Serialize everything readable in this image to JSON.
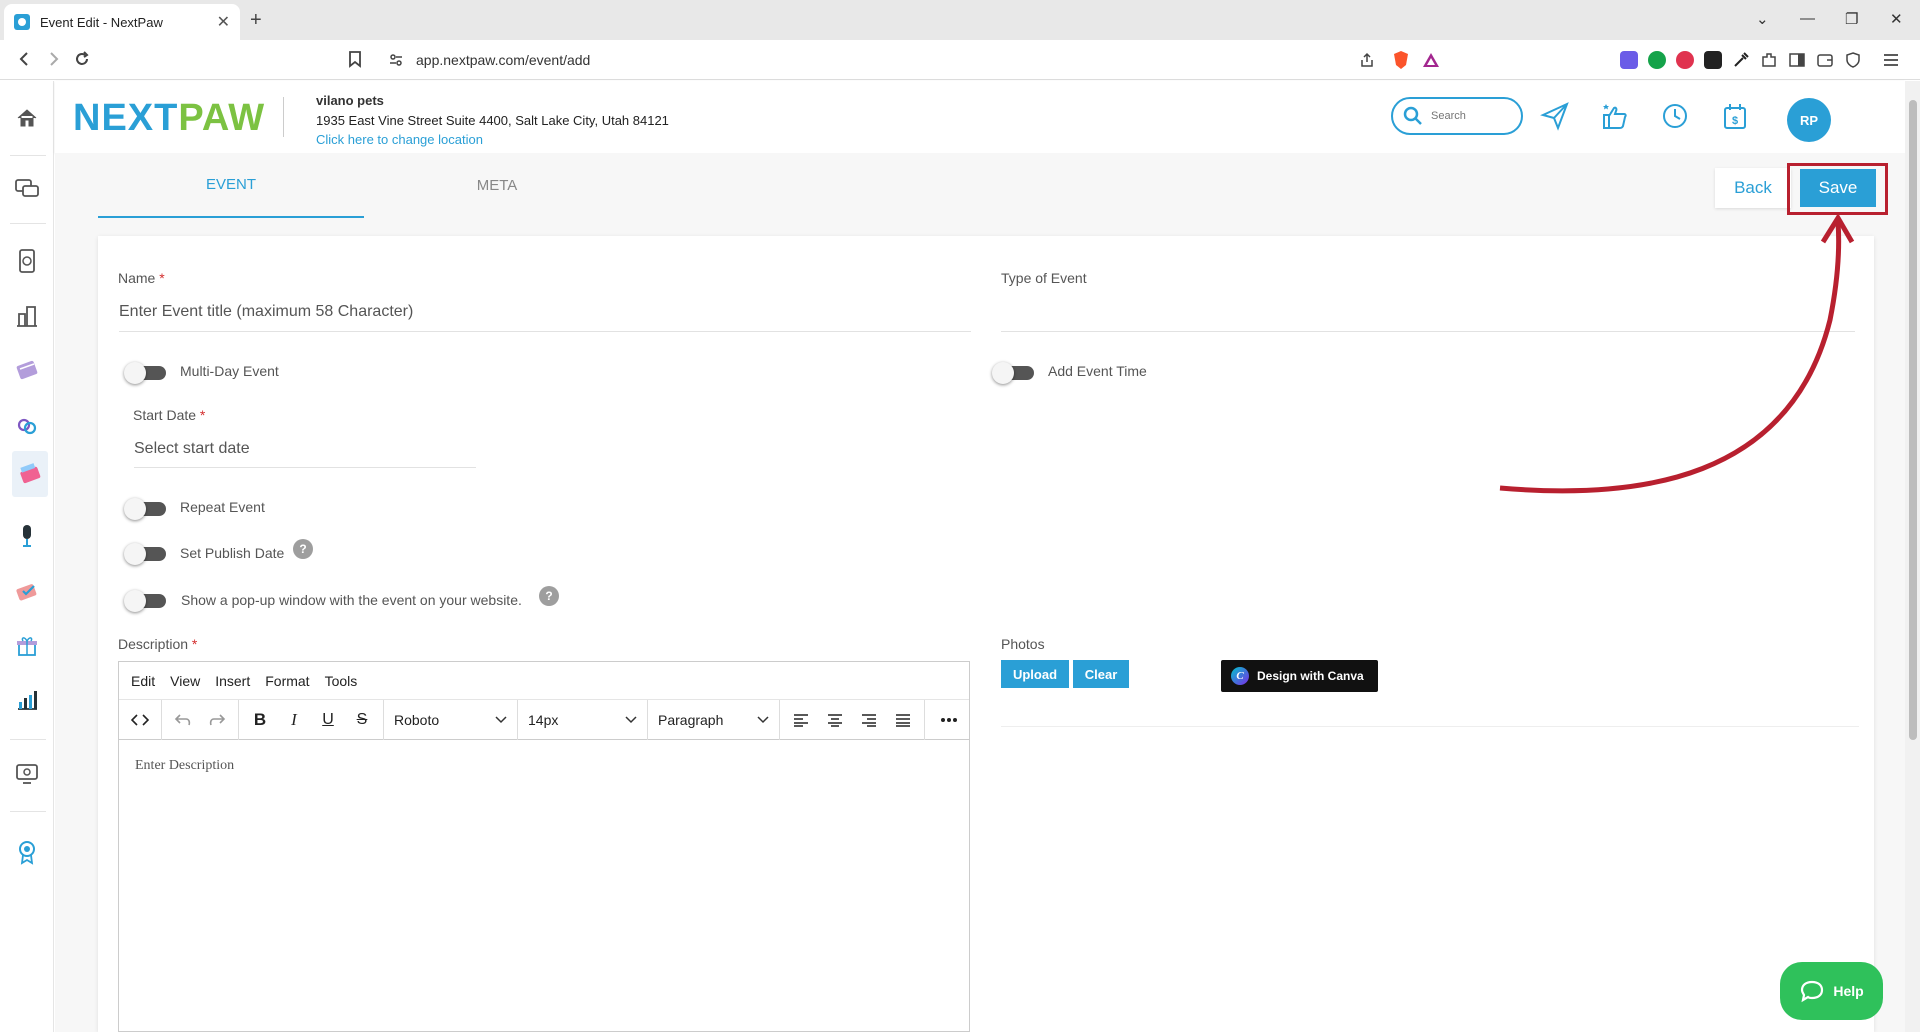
{
  "browser": {
    "tab_title": "Event Edit - NextPaw",
    "url": "app.nextpaw.com/event/add"
  },
  "header": {
    "logo_part1": "NEXT",
    "logo_part2": "PAW",
    "location_name": "vilano pets",
    "location_address": "1935 East Vine Street Suite 4400, Salt Lake City, Utah 84121",
    "change_location": "Click here to change location",
    "search_placeholder": "Search",
    "avatar_initials": "RP"
  },
  "tabs": [
    {
      "label": "EVENT",
      "active": true
    },
    {
      "label": "META",
      "active": false
    }
  ],
  "actions": {
    "back": "Back",
    "save": "Save"
  },
  "form": {
    "name_label": "Name",
    "required_mark": "*",
    "name_placeholder": "Enter Event title (maximum 58 Character)",
    "type_label": "Type of Event",
    "multi_day": "Multi-Day Event",
    "add_time": "Add Event Time",
    "start_date_label": "Start Date",
    "start_date_placeholder": "Select start date",
    "repeat": "Repeat Event",
    "publish_date": "Set Publish Date",
    "popup": "Show a pop-up window with the event on your website.",
    "help_mark": "?",
    "description_label": "Description",
    "photos_label": "Photos"
  },
  "editor": {
    "menu": [
      "Edit",
      "View",
      "Insert",
      "Format",
      "Tools"
    ],
    "font": "Roboto",
    "size": "14px",
    "block": "Paragraph",
    "placeholder": "Enter Description"
  },
  "photos": {
    "upload": "Upload",
    "clear": "Clear",
    "canva": "Design with Canva"
  },
  "help": "Help",
  "colors": {
    "brand_blue": "#2a9fd6",
    "brand_green": "#7cc242",
    "annotation_red": "#b8202f",
    "help_green": "#2fc15b"
  }
}
